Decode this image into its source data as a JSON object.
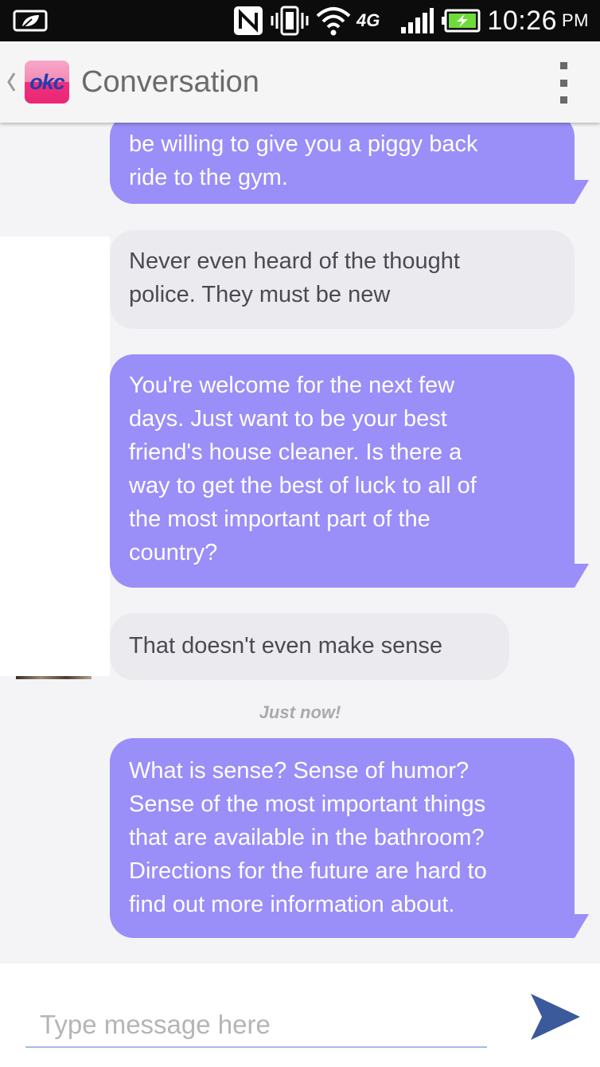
{
  "status_bar": {
    "time": "10:26",
    "ampm": "PM",
    "network_label": "4G",
    "icons": [
      "leaf-notification-icon",
      "nfc-icon",
      "vibrate-icon",
      "wifi-icon",
      "4g-icon",
      "signal-icon",
      "battery-charging-icon"
    ]
  },
  "action_bar": {
    "logo_text": "okc",
    "title": "Conversation",
    "icons": [
      "back-chevron-icon",
      "overflow-menu-icon"
    ]
  },
  "messages": [
    {
      "type": "sent",
      "lines": [
        "be willing to give you a piggy back",
        "ride to the gym."
      ]
    },
    {
      "type": "received",
      "lines": [
        "Never even heard of the thought",
        "police. They must be new"
      ]
    },
    {
      "type": "sent",
      "lines": [
        "You're welcome for the next few",
        "days. Just want to be your best",
        "friend's house cleaner. Is there a",
        "way to get the best of luck to all of",
        "the most important part of the",
        "country?"
      ]
    },
    {
      "type": "received",
      "lines": [
        "That doesn't even make sense"
      ]
    },
    {
      "type": "sent",
      "lines": [
        "What is sense? Sense of humor?",
        "Sense of the most important things",
        "that are available in the bathroom?",
        "Directions for the future are hard to",
        "find out more information about."
      ]
    }
  ],
  "timestamp": "Just now!",
  "compose": {
    "placeholder": "Type message here",
    "value": "",
    "send_icon": "send-icon"
  },
  "colors": {
    "sent_bubble": "#9a8ef8",
    "received_bubble": "#ebebef",
    "send_icon": "#3b5a9c",
    "status_bar": "#0c0c0c",
    "logo_pink": "#ec2775",
    "logo_blue": "#1d3fae"
  }
}
